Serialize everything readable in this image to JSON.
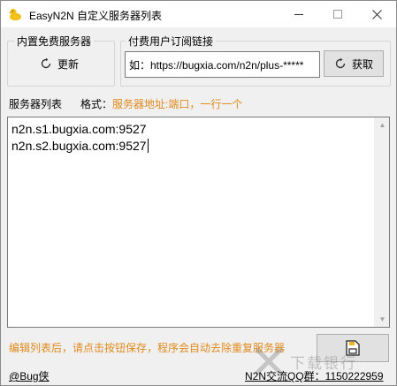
{
  "window": {
    "title": "EasyN2N 自定义服务器列表",
    "icon": "duck-icon"
  },
  "builtin_group": {
    "label": "内置免费服务器",
    "refresh_label": "更新"
  },
  "subscription_group": {
    "label": "付费用户订阅链接",
    "url_value": "如：https://bugxia.com/n2n/plus-*****",
    "fetch_label": "获取"
  },
  "server_list": {
    "label": "服务器列表",
    "format_prefix": "格式：",
    "format_hint": "服务器地址:端口，一行一个",
    "lines": [
      "n2n.s1.bugxia.com:9527",
      "n2n.s2.bugxia.com:9527"
    ]
  },
  "footer": {
    "hint": "编辑列表后，请点击按钮保存，程序会自动去除重复服务器",
    "save_icon": "save-icon",
    "author_prefix": "@",
    "author": "Bug侠",
    "qq_group": "N2N交流QQ群：1150222959",
    "watermark_text": "下载银行"
  },
  "colors": {
    "hint": "#e08a1e",
    "window_bg": "#f0f0f0",
    "button_bg": "#e1e1e1"
  }
}
